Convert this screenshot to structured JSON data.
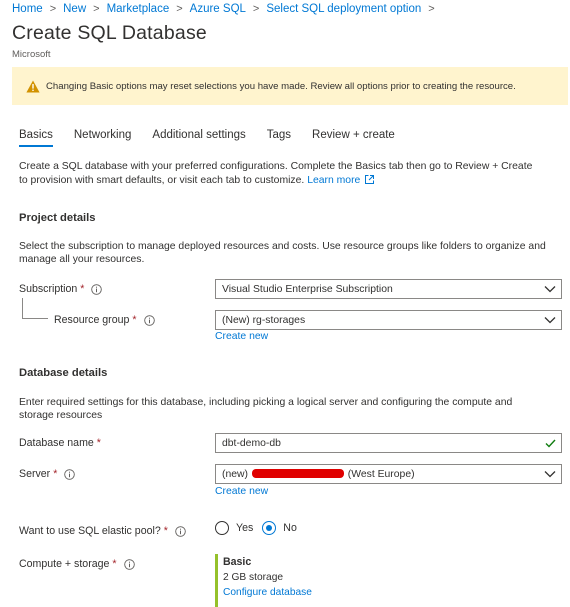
{
  "breadcrumb": [
    {
      "label": "Home"
    },
    {
      "label": "New"
    },
    {
      "label": "Marketplace"
    },
    {
      "label": "Azure SQL"
    },
    {
      "label": "Select SQL deployment option"
    }
  ],
  "page": {
    "title": "Create SQL Database",
    "publisher": "Microsoft"
  },
  "warning": {
    "text": "Changing Basic options may reset selections you have made. Review all options prior to creating the resource.",
    "color": "#fff4ce"
  },
  "tabs": [
    {
      "label": "Basics",
      "active": true
    },
    {
      "label": "Networking"
    },
    {
      "label": "Additional settings"
    },
    {
      "label": "Tags"
    },
    {
      "label": "Review + create"
    }
  ],
  "intro": {
    "text": "Create a SQL database with your preferred configurations. Complete the Basics tab then go to Review + Create to provision with smart defaults, or visit each tab to customize.",
    "learn_more": "Learn more"
  },
  "project": {
    "title": "Project details",
    "desc": "Select the subscription to manage deployed resources and costs. Use resource groups like folders to organize and manage all your resources.",
    "subscription": {
      "label": "Subscription",
      "required": "*",
      "value": "Visual Studio Enterprise Subscription"
    },
    "resource_group": {
      "label": "Resource group",
      "required": "*",
      "value": "(New) rg-storages",
      "create_new": "Create new"
    }
  },
  "database": {
    "title": "Database details",
    "desc": "Enter required settings for this database, including picking a logical server and configuring the compute and storage resources",
    "name": {
      "label": "Database name",
      "required": "*",
      "value": "dbt-demo-db"
    },
    "server": {
      "label": "Server",
      "required": "*",
      "value_prefix": "(new)",
      "value_suffix": "(West Europe)",
      "create_new": "Create new"
    },
    "elastic_pool": {
      "label": "Want to use SQL elastic pool?",
      "required": "*",
      "options": [
        "Yes",
        "No"
      ],
      "selected": "No"
    },
    "compute": {
      "label": "Compute + storage",
      "required": "*",
      "tier": "Basic",
      "size": "2 GB storage",
      "link": "Configure database"
    }
  },
  "colors": {
    "accent": "#0078d4",
    "required": "#a4262c",
    "valid": "#107c10",
    "warning_icon": "#d29200",
    "compute_bar": "#95c12b"
  }
}
